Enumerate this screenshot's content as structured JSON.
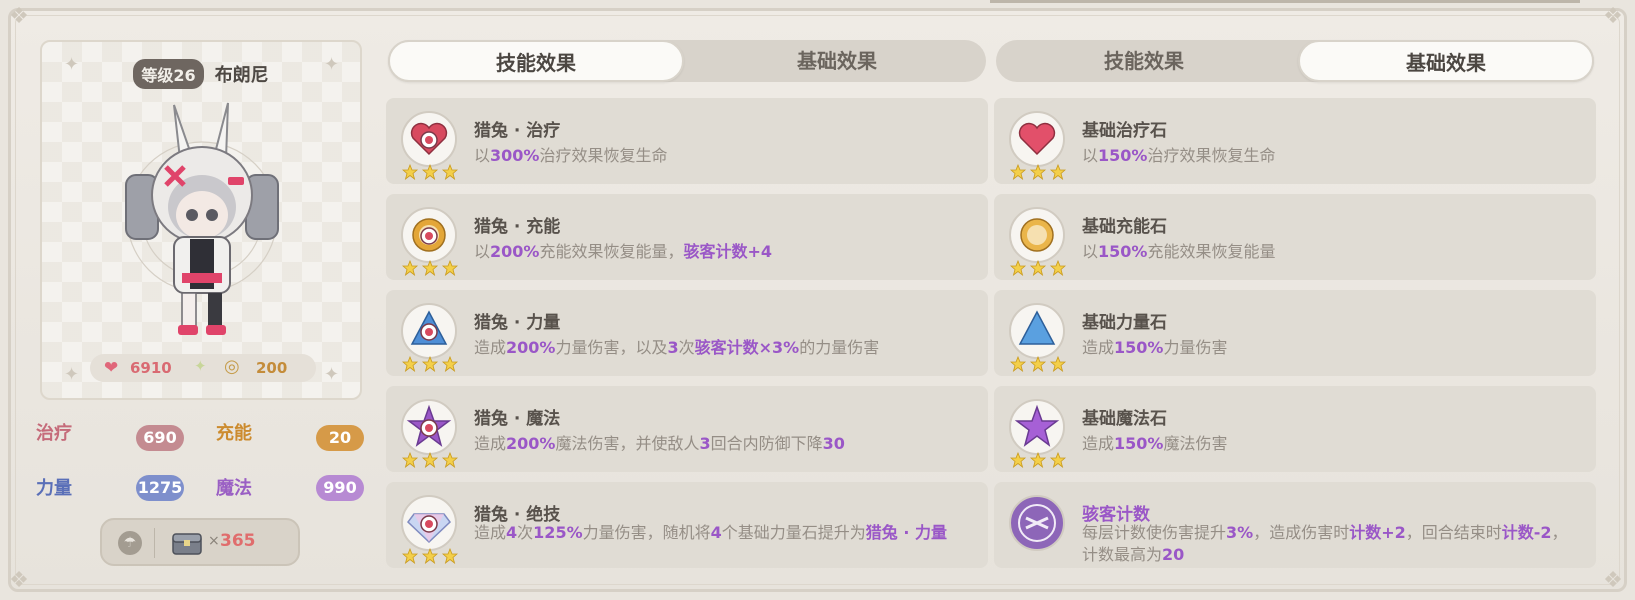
{
  "character": {
    "level_badge": "等级26",
    "name": "布朗尼",
    "hp": "6910",
    "energy": "200"
  },
  "attributes": [
    {
      "label": "治疗",
      "value": "690",
      "label_color": "#c56b7a",
      "pill_color": "#c48b91"
    },
    {
      "label": "充能",
      "value": "20",
      "label_color": "#cc8b2e",
      "pill_color": "#d69a48"
    },
    {
      "label": "力量",
      "value": "1275",
      "label_color": "#5a6fb8",
      "pill_color": "#7e8fcc"
    },
    {
      "label": "魔法",
      "value": "990",
      "label_color": "#9a5fc4",
      "pill_color": "#b78ad3"
    }
  ],
  "item": {
    "times": "×",
    "count": "365"
  },
  "left_panel": {
    "tabs": {
      "skill": "技能效果",
      "base": "基础效果"
    },
    "active_tab": "skill",
    "cards": [
      {
        "icon": "heal-gem-icon",
        "title": "猎兔 · 治疗",
        "desc": [
          {
            "t": "以"
          },
          {
            "h": "300%"
          },
          {
            "t": "治疗效果恢复生命"
          }
        ]
      },
      {
        "icon": "charge-gem-icon",
        "title": "猎兔 · 充能",
        "desc": [
          {
            "t": "以"
          },
          {
            "h": "200%"
          },
          {
            "t": "充能效果恢复能量，"
          },
          {
            "h": "骇客计数+4"
          }
        ]
      },
      {
        "icon": "power-gem-icon",
        "title": "猎兔 · 力量",
        "desc": [
          {
            "t": "造成"
          },
          {
            "h": "200%"
          },
          {
            "t": "力量伤害，以及"
          },
          {
            "h": "3"
          },
          {
            "t": "次"
          },
          {
            "h": "骇客计数×3%"
          },
          {
            "t": "的力量伤害"
          }
        ]
      },
      {
        "icon": "magic-gem-icon",
        "title": "猎兔 · 魔法",
        "desc": [
          {
            "t": "造成"
          },
          {
            "h": "200%"
          },
          {
            "t": "魔法伤害，并使敌人"
          },
          {
            "h": "3"
          },
          {
            "t": "回合内防御下降"
          },
          {
            "h": "30"
          }
        ]
      },
      {
        "icon": "ultimate-gem-icon",
        "title": "猎兔 · 绝技",
        "desc": [
          {
            "t": "造成"
          },
          {
            "h": "4"
          },
          {
            "t": "次"
          },
          {
            "h": "125%"
          },
          {
            "t": "力量伤害，随机将"
          },
          {
            "h": "4"
          },
          {
            "t": "个基础力量石提升为"
          },
          {
            "h": "猎兔 · 力量"
          }
        ]
      }
    ]
  },
  "right_panel": {
    "tabs": {
      "skill": "技能效果",
      "base": "基础效果"
    },
    "active_tab": "base",
    "cards": [
      {
        "icon": "heart-stone-icon",
        "title": "基础治疗石",
        "desc": [
          {
            "t": "以"
          },
          {
            "h": "150%"
          },
          {
            "t": "治疗效果恢复生命"
          }
        ]
      },
      {
        "icon": "charge-stone-icon",
        "title": "基础充能石",
        "desc": [
          {
            "t": "以"
          },
          {
            "h": "150%"
          },
          {
            "t": "充能效果恢复能量"
          }
        ]
      },
      {
        "icon": "power-stone-icon",
        "title": "基础力量石",
        "desc": [
          {
            "t": "造成"
          },
          {
            "h": "150%"
          },
          {
            "t": "力量伤害"
          }
        ]
      },
      {
        "icon": "magic-stone-icon",
        "title": "基础魔法石",
        "desc": [
          {
            "t": "造成"
          },
          {
            "h": "150%"
          },
          {
            "t": "魔法伤害"
          }
        ]
      },
      {
        "icon": "hacker-count-icon",
        "title": "骇客计数",
        "title_color": "#9a57c7",
        "no_stars": true,
        "desc": [
          {
            "t": "每层计数使伤害提升"
          },
          {
            "h": "3%"
          },
          {
            "t": "，造成伤害时"
          },
          {
            "h": "计数+2"
          },
          {
            "t": "，回合结束时"
          },
          {
            "h": "计数-2"
          },
          {
            "t": "，计数最高为"
          },
          {
            "h": "20"
          }
        ]
      }
    ]
  }
}
